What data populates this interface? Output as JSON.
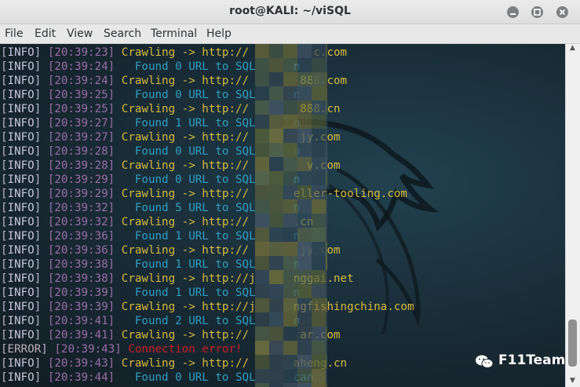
{
  "window": {
    "title": "root@KALI: ~/viSQL"
  },
  "menu": [
    "File",
    "Edit",
    "View",
    "Search",
    "Terminal",
    "Help"
  ],
  "lines": [
    {
      "level": "INFO",
      "time": "20:39:23",
      "kind": "crawl",
      "text": "Crawling -> http://",
      " suffix": "",
      "url": "c.com"
    },
    {
      "level": "INFO",
      "time": "20:39:24",
      "kind": "found",
      "text": "  Found 0 URL to SQL",
      "url": "n"
    },
    {
      "level": "INFO",
      "time": "20:39:24",
      "kind": "crawl",
      "text": "Crawling -> http://",
      "url": "888.com"
    },
    {
      "level": "INFO",
      "time": "20:39:25",
      "kind": "found",
      "text": "  Found 0 URL to SQL",
      "url": "n"
    },
    {
      "level": "INFO",
      "time": "20:39:25",
      "kind": "crawl",
      "text": "Crawling -> http://",
      "url": "888.cn"
    },
    {
      "level": "INFO",
      "time": "20:39:27",
      "kind": "found",
      "text": "  Found 1 URL to SQL",
      "url": "n"
    },
    {
      "level": "INFO",
      "time": "20:39:27",
      "kind": "crawl",
      "text": "Crawling -> http://",
      "url": "jy.com"
    },
    {
      "level": "INFO",
      "time": "20:39:28",
      "kind": "found",
      "text": "  Found 0 URL to SQL",
      "url": "n"
    },
    {
      "level": "INFO",
      "time": "20:39:28",
      "kind": "crawl",
      "text": "Crawling -> http://",
      "url": "v.com"
    },
    {
      "level": "INFO",
      "time": "20:39:29",
      "kind": "found",
      "text": "  Found 0 URL to SQL",
      "url": "n"
    },
    {
      "level": "INFO",
      "time": "20:39:29",
      "kind": "crawl",
      "text": "Crawling -> http://",
      "url": "eller-tooling.com"
    },
    {
      "level": "INFO",
      "time": "20:39:32",
      "kind": "found",
      "text": "  Found 5 URL to SQL",
      "url": "n"
    },
    {
      "level": "INFO",
      "time": "20:39:32",
      "kind": "crawl",
      "text": "Crawling -> http://",
      "url": ".cn"
    },
    {
      "level": "INFO",
      "time": "20:39:36",
      "kind": "found",
      "text": "  Found 1 URL to SQL",
      "url": "n"
    },
    {
      "level": "INFO",
      "time": "20:39:36",
      "kind": "crawl",
      "text": "Crawling -> http://",
      "url": "jy.com"
    },
    {
      "level": "INFO",
      "time": "20:39:38",
      "kind": "found",
      "text": "  Found 1 URL to SQL",
      "url": "n"
    },
    {
      "level": "INFO",
      "time": "20:39:38",
      "kind": "crawl",
      "text": "Crawling -> http://j",
      "url": "nggai.net"
    },
    {
      "level": "INFO",
      "time": "20:39:39",
      "kind": "found",
      "text": "  Found 1 URL to SQL",
      "url": "n"
    },
    {
      "level": "INFO",
      "time": "20:39:39",
      "kind": "crawl",
      "text": "Crawling -> http://j",
      "url": "ngfishingchina.com"
    },
    {
      "level": "INFO",
      "time": "20:39:41",
      "kind": "found",
      "text": "  Found 2 URL to SQL",
      "url": "n"
    },
    {
      "level": "INFO",
      "time": "20:39:41",
      "kind": "crawl",
      "text": "Crawling -> http://",
      "url": "ar.com"
    },
    {
      "level": "ERROR",
      "time": "20:39:43",
      "kind": "error",
      "text": "Connection error!",
      "url": ""
    },
    {
      "level": "INFO",
      "time": "20:39:43",
      "kind": "crawl",
      "text": "Crawling -> http://",
      "url": "aheng.cn"
    },
    {
      "level": "INFO",
      "time": "20:39:44",
      "kind": "found",
      "text": "  Found 0 URL to SQL",
      "url": "can"
    }
  ],
  "watermark": {
    "text": "F11Team",
    "icon": "wechat-icon"
  },
  "colors": {
    "crawl": "#d8ba3d",
    "found": "#2f9fc4",
    "error": "#cc1e2a",
    "timestamp": "#9a6ea7"
  }
}
